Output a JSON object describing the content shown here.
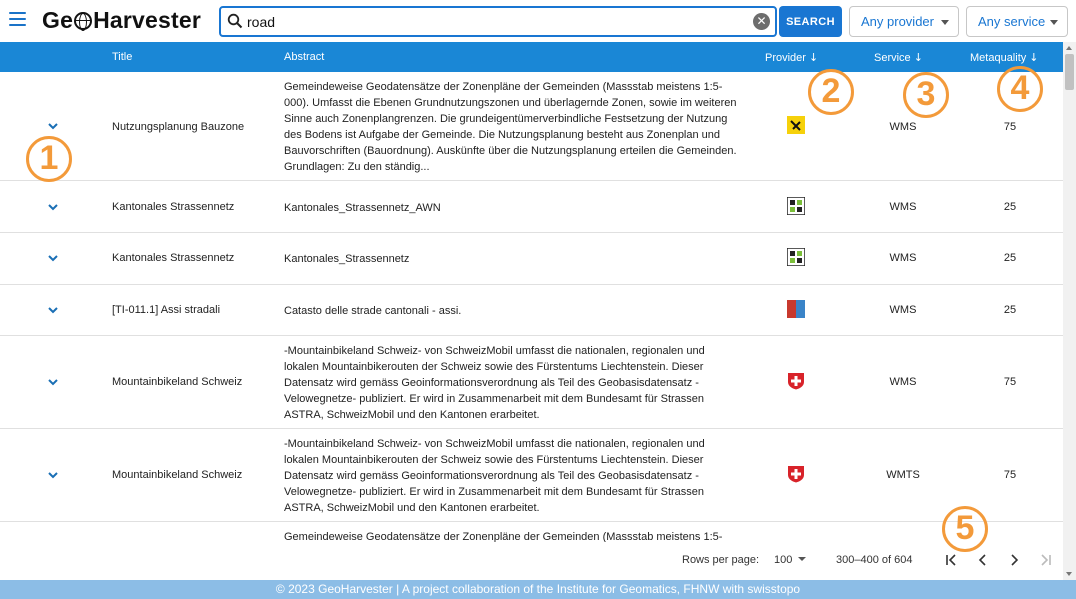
{
  "app": {
    "logo_prefix": "Ge",
    "logo_suffix": "Harvester"
  },
  "search": {
    "value": "road",
    "button_label": "SEARCH"
  },
  "filters": {
    "provider_label": "Any provider",
    "service_label": "Any service"
  },
  "table": {
    "headers": {
      "title": "Title",
      "abstract": "Abstract",
      "provider": "Provider",
      "service": "Service",
      "metaquality": "Metaquality"
    },
    "sort_arrow": "↓",
    "rows": [
      {
        "title": "Nutzungsplanung Bauzone",
        "abstract": "Gemeindeweise Geodatensätze der Zonenpläne der Gemeinden (Massstab meistens 1:5-000). Umfasst die Ebenen Grundnutzungszonen und überlagernde Zonen, sowie im weiteren Sinne auch Zonenplangrenzen. Die grundeigentümerverbindliche Festsetzung der Nutzung des Bodens ist Aufgabe der Gemeinde. Die Nutzungsplanung besteht aus Zonenplan und Bauvorschriften (Bauordnung). Auskünfte über die Nutzungsplanung erteilen die Gemeinden. Grundlagen: Zu den ständig...",
        "provider_icon": "yellow-logo-icon",
        "service": "WMS",
        "metaquality": "75"
      },
      {
        "title": "Kantonales Strassennetz",
        "abstract": "Kantonales_Strassennetz_AWN",
        "provider_icon": "grid-logo-icon",
        "service": "WMS",
        "metaquality": "25"
      },
      {
        "title": "Kantonales Strassennetz",
        "abstract": "Kantonales_Strassennetz",
        "provider_icon": "grid-logo-icon",
        "service": "WMS",
        "metaquality": "25"
      },
      {
        "title": "[TI-011.1] Assi stradali",
        "abstract": "Catasto delle strade cantonali - assi.",
        "provider_icon": "ticino-flag-icon",
        "service": "WMS",
        "metaquality": "25"
      },
      {
        "title": "Mountainbikeland Schweiz",
        "abstract": "-Mountainbikeland Schweiz- von SchweizMobil umfasst die nationalen, regionalen und lokalen Mountainbikerouten der Schweiz sowie des Fürstentums Liechtenstein. Dieser Datensatz wird gemäss Geoinformationsverordnung als Teil des Geobasisdatensatz -Velowegnetze- publiziert. Er wird in Zusammenarbeit mit dem Bundesamt für Strassen ASTRA, SchweizMobil und den Kantonen erarbeitet.",
        "provider_icon": "swiss-cross-icon",
        "service": "WMS",
        "metaquality": "75"
      },
      {
        "title": "Mountainbikeland Schweiz",
        "abstract": "-Mountainbikeland Schweiz- von SchweizMobil umfasst die nationalen, regionalen und lokalen Mountainbikerouten der Schweiz sowie des Fürstentums Liechtenstein. Dieser Datensatz wird gemäss Geoinformationsverordnung als Teil des Geobasisdatensatz -Velowegnetze- publiziert. Er wird in Zusammenarbeit mit dem Bundesamt für Strassen ASTRA, SchweizMobil und den Kantonen erarbeitet.",
        "provider_icon": "swiss-cross-icon",
        "service": "WMTS",
        "metaquality": "75"
      },
      {
        "title": "",
        "abstract": "Gemeindeweise Geodatensätze der Zonenpläne der Gemeinden (Massstab meistens 1:5-",
        "provider_icon": "",
        "service": "",
        "metaquality": ""
      }
    ]
  },
  "pagination": {
    "rows_per_page_label": "Rows per page:",
    "rows_per_page_value": "100",
    "range": "300–400 of 604"
  },
  "footer": {
    "text": "© 2023 GeoHarvester | A project collaboration of the Institute for Geomatics, FHNW with swisstopo"
  },
  "callouts": [
    "1",
    "2",
    "3",
    "4",
    "5"
  ],
  "colors": {
    "accent": "#1976d2",
    "header_bg": "#1a87d6",
    "footer_bg": "#8cbde6",
    "callout": "#f39a3a"
  }
}
